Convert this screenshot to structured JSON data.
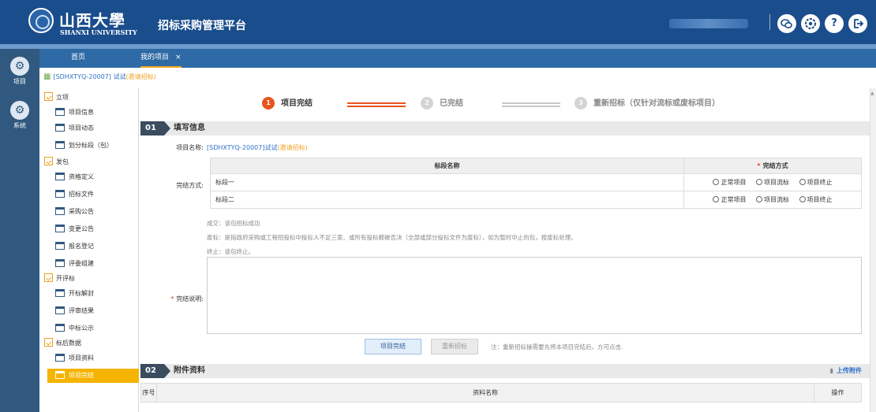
{
  "header": {
    "logo_cn": "山西大學",
    "logo_en": "SHANXI UNIVERSITY",
    "title": "招标采购管理平台",
    "icons": [
      "wechat-icon",
      "settings-icon",
      "help-icon",
      "logout-icon"
    ],
    "help_glyph": "?"
  },
  "leftnav": [
    {
      "label": "项目",
      "icon": "gear-icon"
    },
    {
      "label": "系统",
      "icon": "gear-icon"
    }
  ],
  "tabs": [
    {
      "label": "首页"
    },
    {
      "label": "我的项目",
      "close": "×"
    }
  ],
  "breadcrumb": {
    "code": "[SDHXTYQ-20007] 试试",
    "tag": "(邀请招标)"
  },
  "tree": {
    "groups": [
      {
        "label": "立项",
        "items": [
          "项目信息",
          "项目动态",
          "划分标段（包）"
        ]
      },
      {
        "label": "发包",
        "items": [
          "资格定义",
          "招标文件",
          "采购公告",
          "变更公告",
          "报名登记",
          "评委组建"
        ]
      },
      {
        "label": "开评标",
        "items": [
          "开标解封",
          "评审结果",
          "中标公示"
        ]
      },
      {
        "label": "标后数据",
        "items": [
          "项目资料",
          "项目完结"
        ]
      }
    ],
    "active": "项目完结"
  },
  "steps": [
    {
      "num": "1",
      "label": "项目完结",
      "state": "active"
    },
    {
      "num": "2",
      "label": "已完结",
      "state": "pending"
    },
    {
      "num": "3",
      "label": "重新招标（仅针对流标或废标项目）",
      "state": "pending"
    }
  ],
  "section1": {
    "num": "01",
    "title": "填写信息",
    "project_name_label": "项目名称:",
    "project_name_code": "[SDHXTYQ-20007]试试",
    "project_name_tag": "(邀请招标)",
    "method_label": "完结方式:",
    "table_headers": [
      "标段名称",
      "完结方式"
    ],
    "required_mark": "*",
    "rows": [
      {
        "name": "标段一",
        "options": [
          "正常项目",
          "项目流标",
          "项目终止"
        ]
      },
      {
        "name": "标段二",
        "options": [
          "正常项目",
          "项目流标",
          "项目终止"
        ]
      }
    ],
    "notes": [
      "成交：该包招标成功",
      "废标：是指政府采购或工程招投标中投标人不足三家、或所有投标都被否决（全部或部分投标文件为废标），如为暂时中止的包，按废标处理。",
      "终止：该包终止。"
    ],
    "desc_label": "完结说明:",
    "btn_finish": "项目完结",
    "btn_rebid": "重新招标",
    "btn_note": "注：重新招标操需要先将本项目完结后，方可点击."
  },
  "section2": {
    "num": "02",
    "title": "附件资料",
    "upload_label": "上传附件",
    "table_headers": [
      "序号",
      "资料名称",
      "操作"
    ]
  },
  "colors": {
    "header_bg": "#1a4d8c",
    "active_item": "#f5b400",
    "step_active": "#e8541e",
    "link": "#2f72c8"
  }
}
